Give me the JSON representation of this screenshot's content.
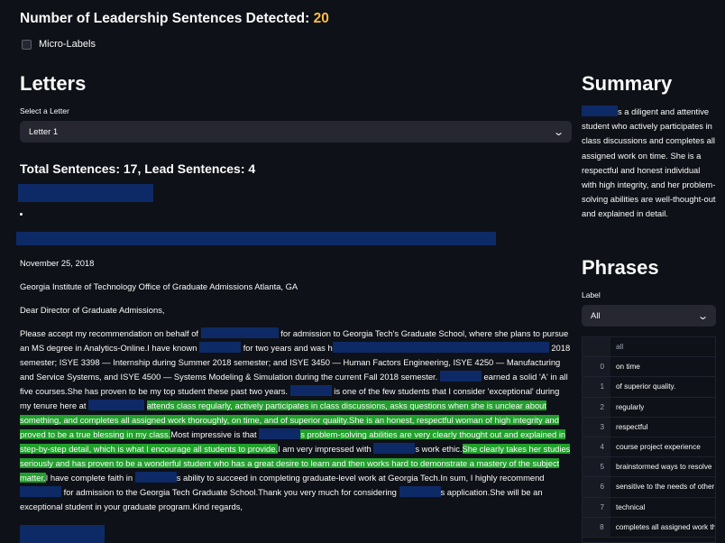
{
  "header": {
    "count_label": "Number of Leadership Sentences Detected:",
    "count_value": "20",
    "micro_label": "Micro-Labels"
  },
  "letters": {
    "heading": "Letters",
    "select_label": "Select a Letter",
    "selected": "Letter 1",
    "totals": "Total Sentences: 17, Lead Sentences: 4"
  },
  "letter": {
    "date": "November 25, 2018",
    "address": "Georgia Institute of Technology Office of Graduate Admissions Atlanta, GA",
    "salutation": "Dear Director of Graduate Admissions,",
    "b1": "Please accept my recommendation on behalf of",
    "b2": "for admission to Georgia Tech's Graduate School, where she plans to pursue an MS degree in Analytics-Online.I have known",
    "b3": "for two years and was h",
    "b4": "2018 semester; ISYE 3398 — Internship during Summer 2018 semester; and ISYE 3450 — Human Factors Engineering, ISYE 4250 — Manufacturing and Service Systems, and ISYE 4500 — Systems Modeling & Simulation during the current Fall 2018 semester.",
    "b5": "earned a solid 'A' in all five courses.She has proven to be my top student these past two years.",
    "b6": "is one of the few students that I consider 'exceptional' during my tenure here at",
    "h1": "attends class regularly, actively participates in class discussions, asks questions when she is unclear about something, and completes all assigned work thoroughly, on time, and of superior quality.",
    "h2": "She is an honest, respectful woman of high integrity and proved to be a true blessing in my class.",
    "b7": "Most impressive is that",
    "h3": "s problem-solving abilities are very clearly thought out and explained in step-by-step detail, which is what I encourage all students to provide.",
    "b8": "I am very impressed with",
    "b9": "s work ethic.",
    "h4": "She clearly takes her studies seriously and has proven to be a wonderful student who has a great desire to learn and then works hard to demonstrate a mastery of the subject matter.",
    "b10": "I have complete faith in",
    "b11": "s ability to succeed in completing graduate-level work at Georgia Tech.In sum, I highly recommend",
    "b12": "for admission to the Georgia Tech Graduate School.Thank you very much for considering",
    "b13": "s application.She will be an exceptional student in your graduate program.Kind regards,"
  },
  "summary": {
    "heading": "Summary",
    "text": "s a diligent and attentive student who actively participates in class discussions and completes all assigned work on time. She is a respectful and honest individual with high integrity, and her problem-solving abilities are well-thought-out and explained in detail."
  },
  "phrases": {
    "heading": "Phrases",
    "label": "Label",
    "selected": "All",
    "column": "all",
    "rows": [
      {
        "i": "0",
        "v": "on time"
      },
      {
        "i": "1",
        "v": "of superior quality."
      },
      {
        "i": "2",
        "v": "regularly"
      },
      {
        "i": "3",
        "v": "respectful"
      },
      {
        "i": "4",
        "v": "course project experience"
      },
      {
        "i": "5",
        "v": "brainstormed ways to resolve"
      },
      {
        "i": "6",
        "v": "sensitive to the needs of other"
      },
      {
        "i": "7",
        "v": "technical"
      },
      {
        "i": "8",
        "v": "completes all assigned work th"
      }
    ]
  }
}
